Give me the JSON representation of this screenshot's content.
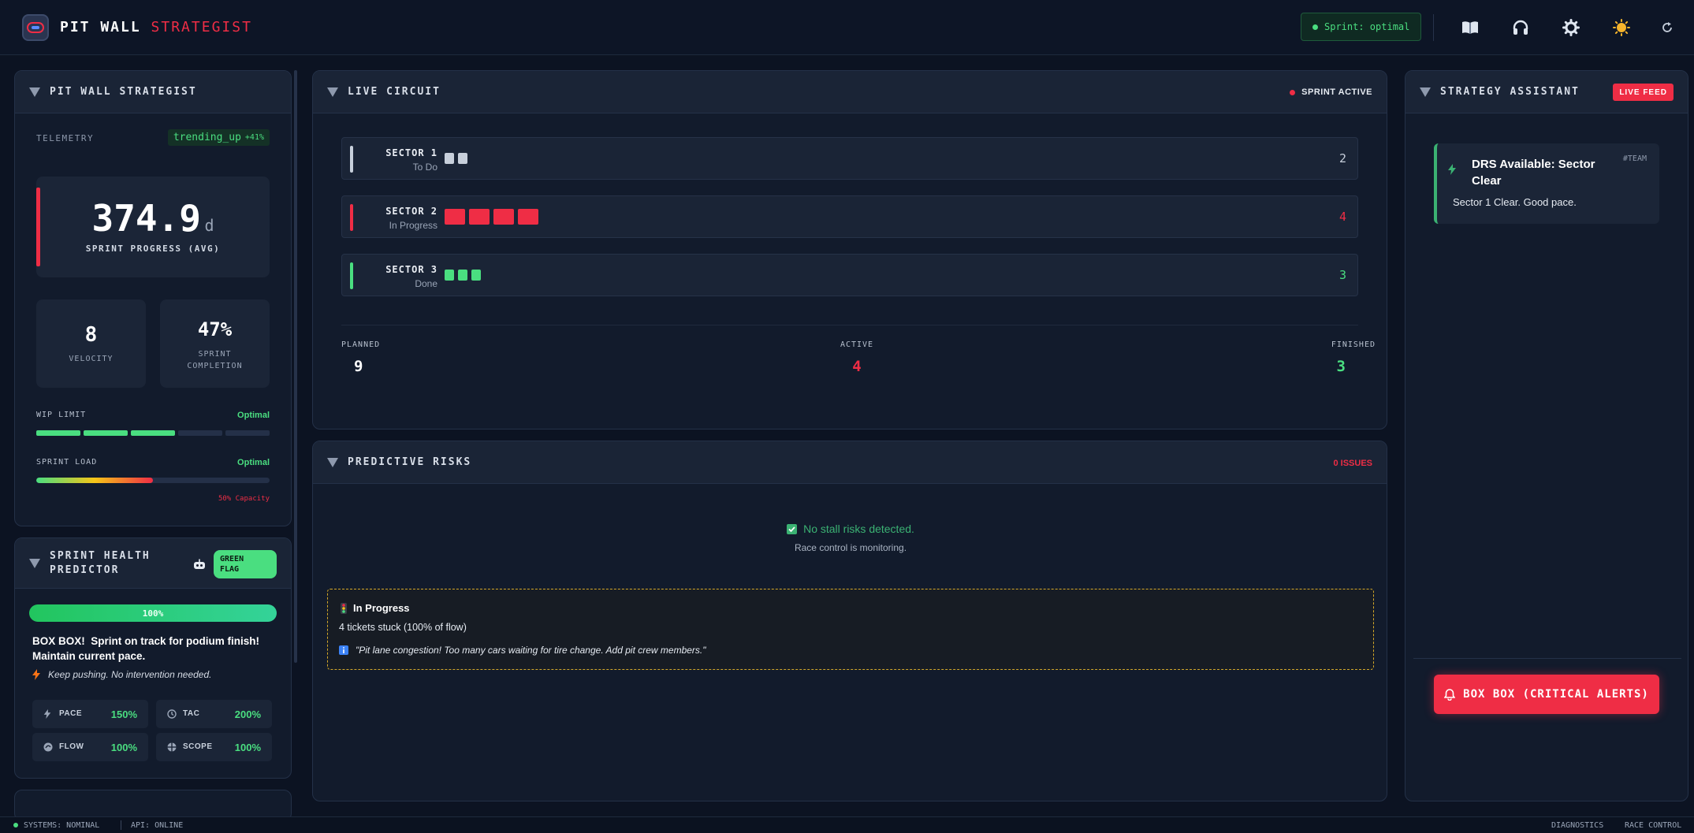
{
  "header": {
    "brand_primary": "PIT WALL",
    "brand_accent": "STRATEGIST",
    "sprint_status": "Sprint: optimal",
    "icons": [
      "book-icon",
      "headphones-icon",
      "gear-icon",
      "sun-icon",
      "refresh-icon"
    ]
  },
  "telemetry_panel": {
    "title": "PIT WALL STRATEGIST",
    "telemetry_label": "TELEMETRY",
    "trend_text": "trending_up",
    "trend_value": "+41%",
    "progress_value": "374.9",
    "progress_unit": "d",
    "progress_label": "SPRINT PROGRESS (AVG)",
    "velocity_value": "8",
    "velocity_label": "VELOCITY",
    "completion_value": "47%",
    "completion_label_1": "SPRINT",
    "completion_label_2": "COMPLETION",
    "wip_label": "WIP LIMIT",
    "wip_status": "Optimal",
    "wip_filled_segments": 3,
    "wip_total_segments": 5,
    "load_label": "SPRINT LOAD",
    "load_status": "Optimal",
    "load_percent": 50,
    "load_caption": "50% Capacity"
  },
  "health_panel": {
    "title_1": "SPRINT HEALTH",
    "title_2": "PREDICTOR",
    "flag_1": "GREEN",
    "flag_2": "FLAG",
    "health_percent": "100%",
    "box_strong": "BOX BOX!",
    "box_text_1": "Sprint on track for podium finish!",
    "box_text_2": "Maintain current pace.",
    "advice": "Keep pushing. No intervention needed.",
    "metrics": [
      {
        "name": "PACE",
        "value": "150%",
        "icon": "bolt-icon"
      },
      {
        "name": "TAC",
        "value": "200%",
        "icon": "clock-icon"
      },
      {
        "name": "FLOW",
        "value": "100%",
        "icon": "flow-icon"
      },
      {
        "name": "SCOPE",
        "value": "100%",
        "icon": "scope-icon"
      }
    ]
  },
  "circuit_panel": {
    "title": "LIVE CIRCUIT",
    "status": "SPRINT ACTIVE",
    "sectors": [
      {
        "name": "SECTOR 1",
        "status": "To Do",
        "count": "2",
        "color": "#c7cfdb"
      },
      {
        "name": "SECTOR 2",
        "status": "In Progress",
        "count": "4",
        "color": "#ef2d45"
      },
      {
        "name": "SECTOR 3",
        "status": "Done",
        "count": "3",
        "color": "#4ade80"
      }
    ],
    "planned_label": "PLANNED",
    "planned_value": "9",
    "active_label": "ACTIVE",
    "active_value": "4",
    "finished_label": "FINISHED",
    "finished_value": "3"
  },
  "risks_panel": {
    "title": "PREDICTIVE RISKS",
    "issues": "0 ISSUES",
    "no_risk": "No stall risks detected.",
    "monitoring": "Race control is monitoring.",
    "alert_title": "In Progress",
    "alert_detail": "4 tickets stuck (100% of flow)",
    "alert_quote": "\"Pit lane congestion! Too many cars waiting for tire change. Add pit crew members.\""
  },
  "assistant_panel": {
    "title": "STRATEGY ASSISTANT",
    "badge": "LIVE FEED",
    "msg_title_1": "DRS Available: Sector",
    "msg_title_2": "Clear",
    "msg_tag": "#TEAM",
    "msg_body": "Sector 1 Clear. Good pace.",
    "cta": "BOX BOX (CRITICAL ALERTS)"
  },
  "footer": {
    "systems": "SYSTEMS: NOMINAL",
    "api": "API: ONLINE",
    "diagnostics": "DIAGNOSTICS",
    "race_control": "RACE CONTROL"
  },
  "colors": {
    "accent_red": "#ef2d45",
    "accent_green": "#4ade80",
    "background": "#0c1322"
  }
}
